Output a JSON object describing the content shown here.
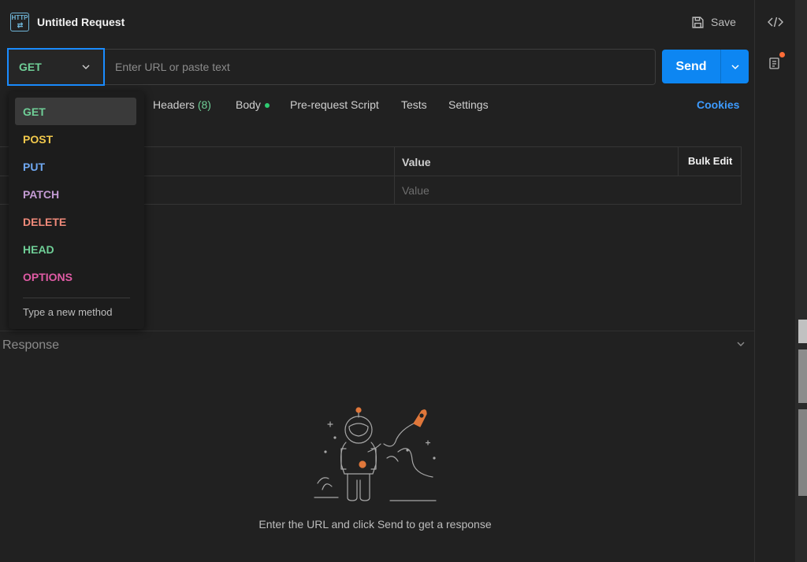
{
  "header": {
    "title": "Untitled Request",
    "save_label": "Save",
    "request_icon_text": "HTTP"
  },
  "url_bar": {
    "method": "GET",
    "placeholder": "Enter URL or paste text",
    "send_label": "Send"
  },
  "tabs": [
    {
      "label": "Headers",
      "count": "(8)"
    },
    {
      "label": "Body"
    },
    {
      "label": "Pre-request Script"
    },
    {
      "label": "Tests"
    },
    {
      "label": "Settings"
    }
  ],
  "cookies_label": "Cookies",
  "params_table": {
    "value_header": "Value",
    "bulk_edit_label": "Bulk Edit",
    "value_placeholder": "Value"
  },
  "method_dropdown": {
    "items": [
      {
        "label": "GET",
        "color": "#6fcf97"
      },
      {
        "label": "POST",
        "color": "#f2c94c"
      },
      {
        "label": "PUT",
        "color": "#6fa8f2"
      },
      {
        "label": "PATCH",
        "color": "#c39bd3"
      },
      {
        "label": "DELETE",
        "color": "#f08a7a"
      },
      {
        "label": "HEAD",
        "color": "#6fcf97"
      },
      {
        "label": "OPTIONS",
        "color": "#e05ba5"
      }
    ],
    "custom_method_label": "Type a new method"
  },
  "response": {
    "title": "Response",
    "empty_message": "Enter the URL and click Send to get a response"
  },
  "colors": {
    "accent": "#0d86f2",
    "link": "#3d9bff",
    "notification_dot": "#ff6c37"
  }
}
